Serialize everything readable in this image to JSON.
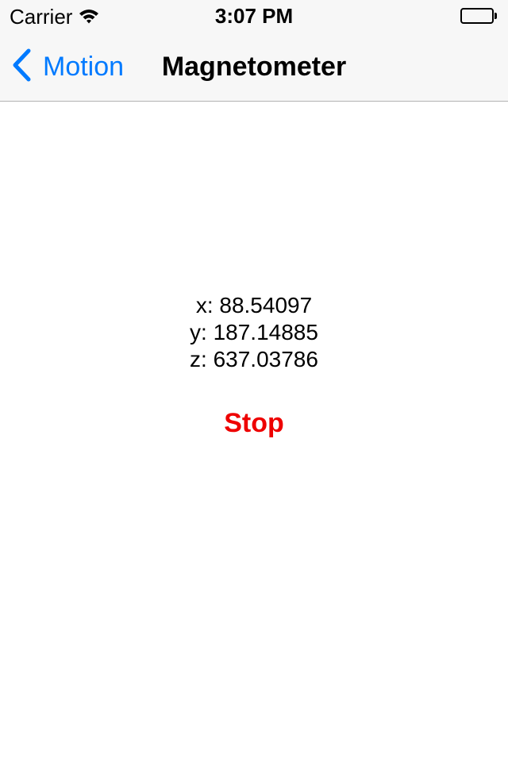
{
  "status_bar": {
    "carrier": "Carrier",
    "time": "3:07 PM",
    "wifi_icon": "wifi-icon",
    "battery_icon": "battery-icon",
    "battery_level": 1.0
  },
  "nav_bar": {
    "back_label": "Motion",
    "back_icon": "chevron-left-icon",
    "title": "Magnetometer",
    "accent_color": "#007aff"
  },
  "readings": {
    "x": "x: 88.54097",
    "y": "y: 187.14885",
    "z": "z: 637.03786"
  },
  "actions": {
    "stop_label": "Stop",
    "stop_color": "#ee0000"
  }
}
